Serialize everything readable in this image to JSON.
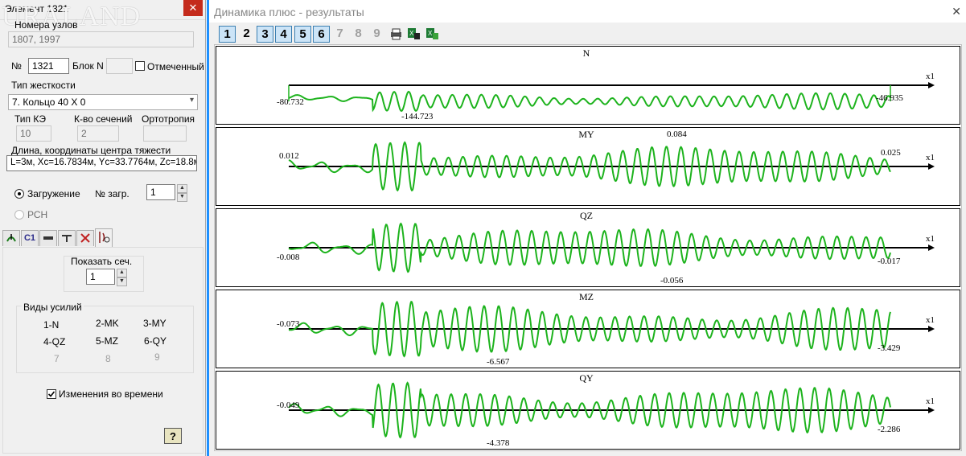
{
  "left_window": {
    "title": "Элемент 1321",
    "watermark": "URALAND",
    "close_label": "✕",
    "nodes_label": "Номера узлов",
    "nodes_value": "1807, 1997",
    "num_label": "№",
    "num_value": "1321",
    "block_label": "Блок N",
    "block_value": "",
    "marked_label": "Отмеченный",
    "stiffness_label": "Тип жесткости",
    "stiffness_value": "7. Кольцо 40 X 0",
    "fe_type_label": "Тип КЭ",
    "fe_type_value": "10",
    "sections_label": "К-во сечений",
    "sections_value": "2",
    "ortho_label": "Ортотропия",
    "ortho_value": "",
    "geom_label": "Длина, координаты центра тяжести",
    "geom_value": "L=3м, Xc=16.7834м, Yc=33.7764м, Zc=18.8м",
    "loading_label": "Загружение",
    "load_num_label": "№ загр.",
    "load_num_value": "1",
    "rsn_label": "РСН",
    "tabs": [
      "",
      "C1",
      "",
      "",
      "",
      ""
    ],
    "show_sec_label": "Показать сеч.",
    "show_sec_value": "1",
    "forces_label": "Виды усилий",
    "forces": [
      "1-N",
      "2-MK",
      "3-MY",
      "4-QZ",
      "5-MZ",
      "6-QY",
      "7",
      "8",
      "9"
    ],
    "time_changes_label": "Изменения во времени",
    "help_label": "?"
  },
  "right_window": {
    "title": "Динамика плюс - результаты",
    "close_label": "✕",
    "toolbar_numbers": [
      "1",
      "2",
      "3",
      "4",
      "5",
      "6",
      "7",
      "8",
      "9"
    ],
    "pressed": [
      1,
      3,
      4,
      5,
      6
    ],
    "colors": {
      "curve": "#1db31d",
      "axis": "#000000"
    },
    "axis_label": "x1",
    "panels": [
      {
        "name": "N",
        "start_label": "-80.732",
        "min_label": "-144.723",
        "end_label": "-46.935"
      },
      {
        "name": "MY",
        "start_label": "0.012",
        "max_label": "0.084",
        "end_label": "0.025"
      },
      {
        "name": "QZ",
        "start_label": "-0.008",
        "min_label": "-0.056",
        "end_label": "-0.017"
      },
      {
        "name": "MZ",
        "start_label": "-0.073",
        "min_label": "-6.567",
        "end_label": "-3.429"
      },
      {
        "name": "QY",
        "start_label": "-0.049",
        "min_label": "-4.378",
        "end_label": "-2.286"
      }
    ]
  }
}
